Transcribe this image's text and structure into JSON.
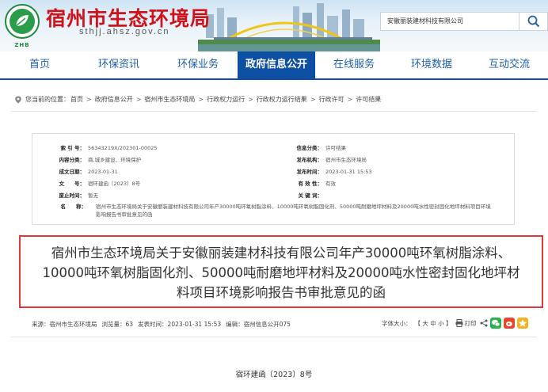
{
  "header": {
    "site_title": "宿州市生态环境局",
    "site_domain": "sthjj.ahsz.gov.cn",
    "logo_text": "ZHB",
    "search_value": "安徽丽装建材科技有限公司"
  },
  "nav": {
    "items": [
      {
        "label": "首页"
      },
      {
        "label": "环保资讯"
      },
      {
        "label": "环保业务"
      },
      {
        "label": "政府信息公开",
        "active": true
      },
      {
        "label": "在线服务"
      },
      {
        "label": "环境数据"
      },
      {
        "label": "互动交流"
      }
    ]
  },
  "breadcrumb": {
    "prefix": "您当前的位置：",
    "items": [
      "首页",
      "政府信息公开",
      "宿州市生态环境局",
      "行政权力运行",
      "行政权力运行结果",
      "行政许可",
      "许可结果"
    ]
  },
  "info": {
    "index_label": "索 引 号：",
    "index_value": "56343219X/202301-00025",
    "category_label": "信息分类：",
    "category_value": "许可结果",
    "content_label": "内容分类：",
    "content_value": "商,城乡建设、环境保护",
    "publisher_label": "发布机构：",
    "publisher_value": "宿州市生态环境局",
    "created_label": "成文日期：",
    "created_value": "2023-01-31",
    "published_label": "发布时间：",
    "published_value": "2023-01-31 15:53",
    "docno_label": "文　　号：",
    "docno_value": "宿环建函〔2023〕8号",
    "validity_label": "有 效 性：",
    "validity_value": "有效",
    "expire_label": "废止时间：",
    "expire_value": "暂无",
    "keywords_label": "关 键 词：",
    "keywords_value": "",
    "name_label": "名　　称：",
    "name_value": "宿州市生态环境局关于安徽丽装建材科技有限公司年产30000吨环氧树脂涂料、10000吨环氧树脂固化剂、50000吨耐磨地坪材料及20000吨水性密封固化地坪材料项目环境影响报告书审批意见的函"
  },
  "article": {
    "title": "宿州市生态环境局关于安徽丽装建材科技有限公司年产30000吨环氧树脂涂料、10000吨环氧树脂固化剂、50000吨耐磨地坪材料及20000吨水性密封固化地坪材料项目环境影响报告书审批意见的函",
    "source": "来源：宿州市生态环境局",
    "views": "浏览量：63",
    "time": "发表时间：2023-01-31 15:53",
    "editor": "编辑：宿州信息公开075",
    "font_label": "字体大小：",
    "font_options": "【 大 中 小 】",
    "print_label": "打印",
    "doc_number": "宿环建函〔2023〕8号"
  },
  "colors": {
    "brand_red": "#d0121b",
    "nav_blue": "#0d4fa3",
    "title_border": "#e23a3a",
    "wechat_green": "#2bb34a",
    "weibo_red": "#e8462b",
    "qzone_yellow": "#f2b21b"
  }
}
